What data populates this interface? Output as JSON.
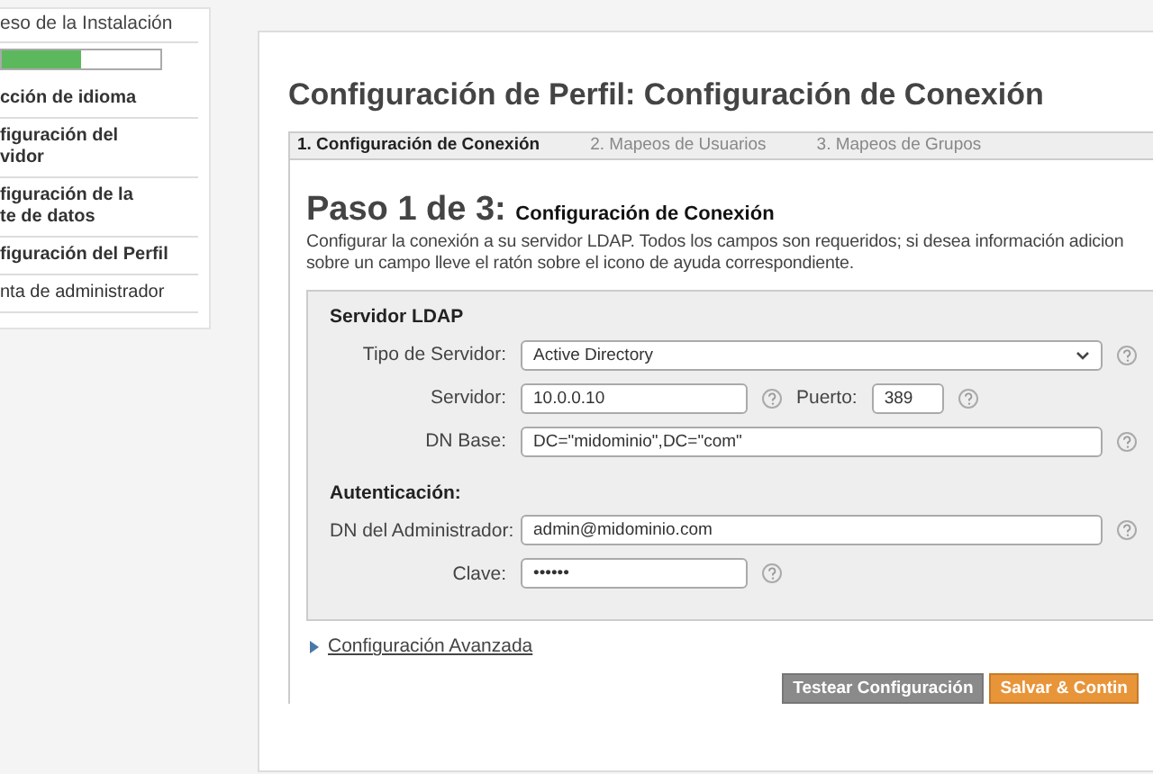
{
  "sidebar": {
    "title": "eso de la Instalación",
    "progress": {
      "level": 0.5
    },
    "items": [
      {
        "label": "cción de idioma",
        "done": true
      },
      {
        "label": "figuración del\nvidor",
        "done": true
      },
      {
        "label": "figuración de la\nte de datos",
        "done": true
      },
      {
        "label": "figuración del Perfil",
        "done": true
      },
      {
        "label": "nta de administrador",
        "done": false
      }
    ]
  },
  "page_title": "Configuración de Perfil: Configuración de Conexión",
  "tabs": [
    {
      "label": "1. Configuración de Conexión",
      "selected": true
    },
    {
      "label": "2. Mapeos de Usuarios",
      "selected": false
    },
    {
      "label": "3. Mapeos de Grupos",
      "selected": false
    }
  ],
  "step": {
    "prefix": "Paso 1 de 3:",
    "title": "Configuración de Conexión",
    "description": "Configurar la conexión a su servidor LDAP. Todos los campos son requeridos; si desea información adicion\nsobre un campo lleve el ratón sobre el icono de ayuda correspondiente."
  },
  "sections": [
    {
      "title": "Servidor LDAP",
      "rows": [
        {
          "fields": [
            {
              "label": "Tipo de Servidor:",
              "kind": "select",
              "value": "Active Directory"
            }
          ]
        },
        {
          "fields": [
            {
              "label": "Servidor:",
              "kind": "text",
              "value": "10.0.0.10"
            },
            {
              "label": "Puerto:",
              "kind": "text",
              "value": "389"
            }
          ]
        },
        {
          "fields": [
            {
              "label": "DN Base:",
              "kind": "text",
              "value": "DC=\"midominio\",DC=\"com\""
            }
          ]
        }
      ]
    },
    {
      "title": "Autenticación:",
      "rows": [
        {
          "fields": [
            {
              "label": "DN del Administrador:",
              "kind": "text",
              "value": "admin@midominio.com"
            }
          ]
        },
        {
          "fields": [
            {
              "label": "Clave:",
              "kind": "password",
              "value": "••••••"
            }
          ]
        }
      ]
    }
  ],
  "advanced_link": "Configuración Avanzada",
  "buttons": [
    {
      "label": "Testear Configuración",
      "kind": "secondary"
    },
    {
      "label": "Salvar & Contin",
      "kind": "primary"
    }
  ]
}
